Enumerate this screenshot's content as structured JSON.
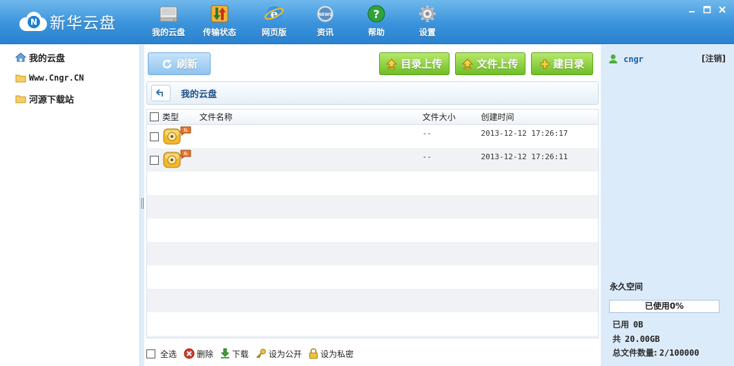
{
  "app": {
    "logo_text": "新华云盘",
    "logo_badge": "N"
  },
  "nav": [
    {
      "label": "我的云盘",
      "icon": "disk-icon"
    },
    {
      "label": "传输状态",
      "icon": "transfer-icon"
    },
    {
      "label": "网页版",
      "icon": "ie-browser-icon"
    },
    {
      "label": "资讯",
      "icon": "news-icon"
    },
    {
      "label": "帮助",
      "icon": "help-icon"
    },
    {
      "label": "设置",
      "icon": "gear-icon"
    }
  ],
  "sidebar": {
    "items": [
      {
        "label": "我的云盘",
        "icon": "home-icon"
      },
      {
        "label": "Www.Cngr.CN",
        "icon": "folder-icon"
      },
      {
        "label": "河源下载站",
        "icon": "folder-icon"
      }
    ]
  },
  "toolbar": {
    "refresh": "刷新",
    "upload_dir": "目录上传",
    "upload_file": "文件上传",
    "mkdir": "建目录"
  },
  "path": {
    "current": "我的云盘"
  },
  "table": {
    "headers": {
      "type": "类型",
      "name": "文件名称",
      "size": "文件大小",
      "time": "创建时间"
    },
    "rows": [
      {
        "name": "",
        "size": "--",
        "time": "2013-12-12 17:26:17"
      },
      {
        "name": "",
        "size": "--",
        "time": "2013-12-12 17:26:11"
      }
    ],
    "empty_rows": 8
  },
  "footer": {
    "select_all": "全选",
    "delete": "删除",
    "download": "下载",
    "set_public": "设为公开",
    "set_private": "设为私密"
  },
  "account": {
    "username": "cngr",
    "logout": "[注销]",
    "space_title": "永久空间",
    "usage_text": "已使用0%",
    "usage_fraction": 0,
    "used_label": "已用",
    "used_value": "0B",
    "total_label": "共",
    "total_value": "20.00GB",
    "file_count_label": "总文件数量:",
    "file_count_value": "2/100000"
  },
  "colors": {
    "header_blue": "#3a93db",
    "green_button": "#6fbd27",
    "panel_bg": "#dcebfa"
  }
}
